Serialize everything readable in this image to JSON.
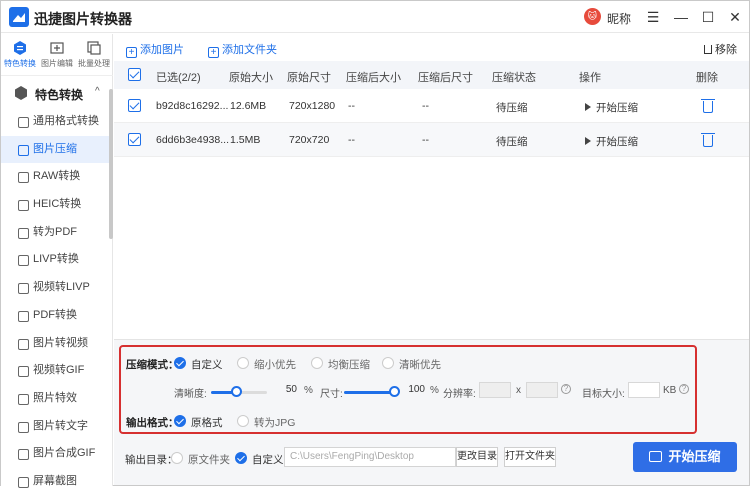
{
  "app": {
    "title": "迅捷图片转换器",
    "nickname": "昵称",
    "avatar_text": "🐱"
  },
  "window_controls": {
    "menu": "☰",
    "minimize": "—",
    "maximize": "☐",
    "close": "✕"
  },
  "left_tabs": [
    {
      "label": "特色转换",
      "active": true
    },
    {
      "label": "图片编辑",
      "active": false
    },
    {
      "label": "批量处理",
      "active": false
    }
  ],
  "category": {
    "label": "特色转换",
    "chevron": "^"
  },
  "nav": [
    {
      "label": "通用格式转换",
      "active": false
    },
    {
      "label": "图片压缩",
      "active": true
    },
    {
      "label": "RAW转换",
      "active": false
    },
    {
      "label": "HEIC转换",
      "active": false
    },
    {
      "label": "转为PDF",
      "active": false
    },
    {
      "label": "LIVP转换",
      "active": false
    },
    {
      "label": "视频转LIVP",
      "active": false
    },
    {
      "label": "PDF转换",
      "active": false
    },
    {
      "label": "图片转视频",
      "active": false
    },
    {
      "label": "视频转GIF",
      "active": false
    },
    {
      "label": "照片特效",
      "active": false
    },
    {
      "label": "图片转文字",
      "active": false
    },
    {
      "label": "图片合成GIF",
      "active": false
    },
    {
      "label": "屏幕截图",
      "active": false
    }
  ],
  "toolbar": {
    "add_image": "添加图片",
    "add_folder": "添加文件夹",
    "remove": "移除"
  },
  "table": {
    "headers": {
      "selected": "已选(2/2)",
      "orig_size": "原始大小",
      "orig_dim": "原始尺寸",
      "comp_size": "压缩后大小",
      "comp_dim": "压缩后尺寸",
      "status": "压缩状态",
      "action": "操作",
      "delete": "删除"
    },
    "rows": [
      {
        "name": "b92d8c16292...",
        "orig_size": "12.6MB",
        "orig_dim": "720x1280",
        "comp_size": "--",
        "comp_dim": "--",
        "status": "待压缩",
        "action": "开始压缩"
      },
      {
        "name": "6dd6b3e4938...",
        "orig_size": "1.5MB",
        "orig_dim": "720x720",
        "comp_size": "--",
        "comp_dim": "--",
        "status": "待压缩",
        "action": "开始压缩"
      }
    ]
  },
  "settings": {
    "mode_label": "压缩模式：",
    "modes": [
      {
        "label": "自定义",
        "selected": true
      },
      {
        "label": "缩小优先",
        "selected": false
      },
      {
        "label": "均衡压缩",
        "selected": false
      },
      {
        "label": "清晰优先",
        "selected": false
      }
    ],
    "clarity_label": "清晰度:",
    "clarity_value": "50",
    "clarity_unit": "%",
    "clarity_level": 0.5,
    "size_label": "尺寸:",
    "size_value": "100",
    "size_unit": "%",
    "size_level": 1.0,
    "resolution_label": "分辨率:",
    "res_x": "x",
    "target_label": "目标大小:",
    "target_unit": "KB",
    "help": "?",
    "format_label": "输出格式：",
    "formats": [
      {
        "label": "原格式",
        "selected": true
      },
      {
        "label": "转为JPG",
        "selected": false
      }
    ]
  },
  "output": {
    "label": "输出目录：",
    "orig_folder": "原文件夹",
    "custom": "自定义",
    "path": "C:\\Users\\FengPing\\Desktop",
    "change_btn": "更改目录",
    "open_btn": "打开文件夹",
    "start_btn": "开始压缩"
  },
  "colors": {
    "accent": "#1e6fe8",
    "highlight": "#d63030"
  }
}
